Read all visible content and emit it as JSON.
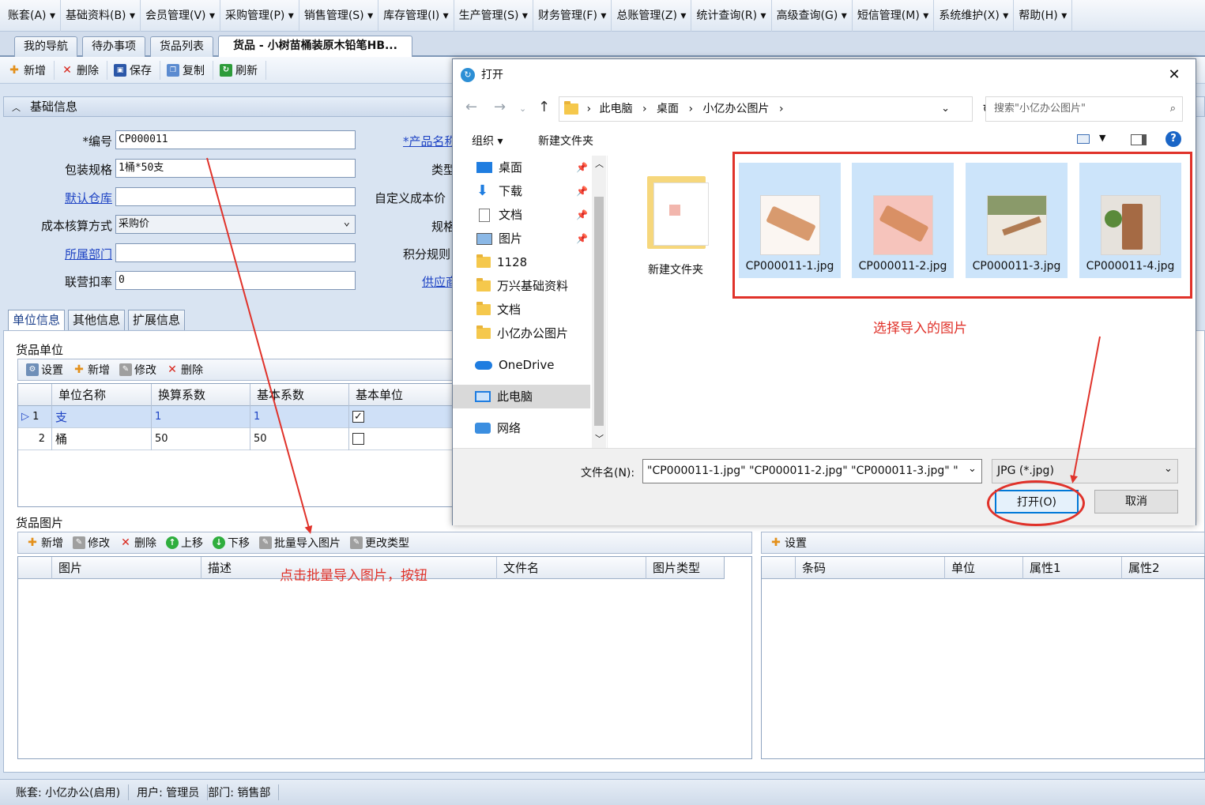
{
  "menu": [
    "账套(A) ▾",
    "基础资料(B) ▾",
    "会员管理(V) ▾",
    "采购管理(P) ▾",
    "销售管理(S) ▾",
    "库存管理(I) ▾",
    "生产管理(S) ▾",
    "财务管理(F) ▾",
    "总账管理(Z) ▾",
    "统计查询(R) ▾",
    "高级查询(G) ▾",
    "短信管理(M) ▾",
    "系统维护(X) ▾",
    "帮助(H) ▾"
  ],
  "doc_tabs": [
    "我的导航",
    "待办事项",
    "货品列表",
    "货品 - 小树苗桶装原木铅笔HB..."
  ],
  "toolbar": {
    "new": "新增",
    "delete": "删除",
    "save": "保存",
    "copy": "复制",
    "refresh": "刷新"
  },
  "basic": {
    "title": "基础信息",
    "code_label": "*编号",
    "code_value": "CP000011",
    "spec_label": "包装规格",
    "spec_value": "1桶*50支",
    "warehouse_label": "默认仓库",
    "cost_label": "成本核算方式",
    "cost_value": "采购价",
    "dept_label": "所属部门",
    "discount_label": "联营扣率",
    "discount_value": "0",
    "product_name_label": "*产品名称",
    "type_label": "类型",
    "custom_cost_label": "自定义成本价",
    "spec2_label": "规格",
    "points_label": "积分规则",
    "supplier_label": "供应商"
  },
  "subtabs": [
    "单位信息",
    "其他信息",
    "扩展信息"
  ],
  "units": {
    "title": "货品单位",
    "toolbar": {
      "settings": "设置",
      "new": "新增",
      "edit": "修改",
      "delete": "删除"
    },
    "columns": [
      "单位名称",
      "换算系数",
      "基本系数",
      "基本单位"
    ],
    "rows": [
      {
        "index": "1",
        "name": "支",
        "factor": "1",
        "base": "1",
        "is_base": true
      },
      {
        "index": "2",
        "name": "桶",
        "factor": "50",
        "base": "50",
        "is_base": false
      }
    ]
  },
  "images": {
    "title": "货品图片",
    "toolbar": {
      "new": "新增",
      "edit": "修改",
      "delete": "删除",
      "up": "上移",
      "down": "下移",
      "batch": "批量导入图片",
      "change": "更改类型"
    },
    "columns": [
      "图片",
      "描述",
      "文件名",
      "图片类型"
    ]
  },
  "barcodes": {
    "toolbar": {
      "settings": "设置"
    },
    "columns": [
      "条码",
      "单位",
      "属性1",
      "属性2"
    ]
  },
  "status": {
    "account": "账套: 小亿办公(启用)",
    "user": "用户: 管理员",
    "dept": "部门: 销售部"
  },
  "dialog": {
    "title": "打开",
    "close": "✕",
    "path": [
      "此电脑",
      "桌面",
      "小亿办公图片"
    ],
    "search_placeholder": "搜索\"小亿办公图片\"",
    "organize": "组织 ▾",
    "new_folder": "新建文件夹",
    "tree": [
      "桌面",
      "下载",
      "文档",
      "图片",
      "1128",
      "万兴基础资料",
      "文档",
      "小亿办公图片",
      "OneDrive",
      "此电脑",
      "网络"
    ],
    "folder_tile": "新建文件夹",
    "files": [
      "CP000011-1.jpg",
      "CP000011-2.jpg",
      "CP000011-3.jpg",
      "CP000011-4.jpg"
    ],
    "filename_label": "文件名(N):",
    "filename_value": "\"CP000011-1.jpg\" \"CP000011-2.jpg\" \"CP000011-3.jpg\" \"",
    "filetype": "JPG (*.jpg)",
    "open": "打开(O)",
    "cancel": "取消"
  },
  "annotations": {
    "select_images": "选择导入的图片",
    "click_batch": "点击批量导入图片，按钮"
  },
  "colors": {
    "annotation": "#e0322a",
    "selection": "#cce4fa",
    "link": "#1f44c4"
  }
}
